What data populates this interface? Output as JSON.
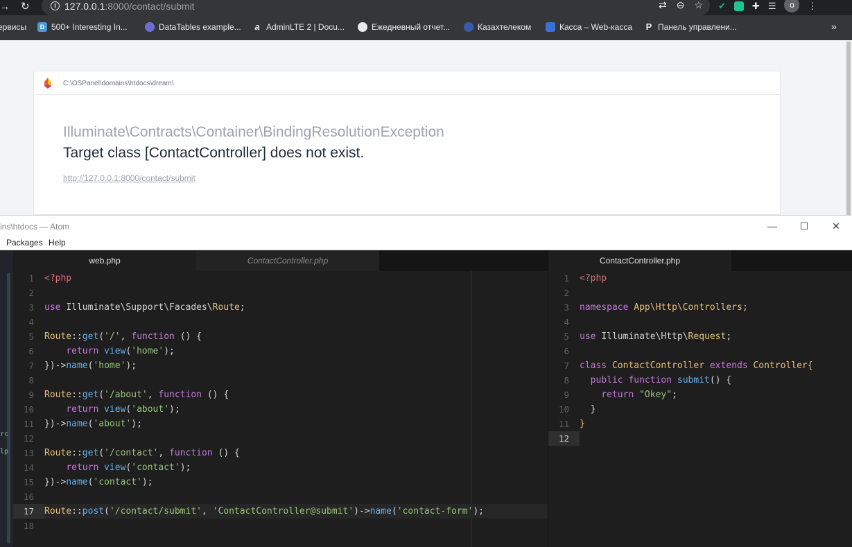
{
  "browser": {
    "url_host": "127.0.0.1",
    "url_rest": ":8000/contact/submit",
    "bookmarks": [
      "ервисы",
      "500+ Interesting In...",
      "DataTables example...",
      "AdminLTE 2 | Docu...",
      "Ежедневный отчет...",
      "Казахтелеком",
      "Касса – Web-касса",
      "Панель управлени..."
    ],
    "avatar_letter": "о",
    "more": "»"
  },
  "error_page": {
    "path": "C:\\OSPanel\\domains\\htdocs\\dream\\",
    "exception_class": "Illuminate\\Contracts\\Container\\BindingResolutionException",
    "message": "Target class [ContactController] does not exist.",
    "url": "http://127.0.0.1:8000/contact/submit"
  },
  "atom": {
    "title": "ins\\htdocs — Atom",
    "menu": [
      "Packages",
      "Help"
    ],
    "tree_fragments": [
      "rc",
      "lp"
    ],
    "left_tabs": [
      "web.php",
      "ContactController.php"
    ],
    "right_tabs": [
      "ContactController.php"
    ],
    "left_lines": [
      "1",
      "2",
      "3",
      "4",
      "5",
      "6",
      "7",
      "8",
      "9",
      "10",
      "11",
      "12",
      "13",
      "14",
      "15",
      "16",
      "17",
      "18"
    ],
    "right_lines": [
      "1",
      "2",
      "3",
      "4",
      "5",
      "6",
      "7",
      "8",
      "9",
      "10",
      "11",
      "12"
    ],
    "web_php": {
      "open_tag": "<?php",
      "use_ns": "Illuminate\\Support\\Facades\\",
      "use_cls": "Route",
      "routes": [
        {
          "method": "get",
          "path": "'/'",
          "view": "'home'",
          "name": "'home'"
        },
        {
          "method": "get",
          "path": "'/about'",
          "view": "'about'",
          "name": "'about'"
        },
        {
          "method": "get",
          "path": "'/contact'",
          "view": "'contact'",
          "name": "'contact'"
        }
      ],
      "post_path": "'/contact/submit'",
      "post_action": "'ContactController@submit'",
      "post_name": "'contact-form'"
    },
    "controller_php": {
      "open_tag": "<?php",
      "namespace": "App\\Http\\Controllers",
      "use_ns": "Illuminate\\Http\\",
      "use_cls": "Request",
      "class_name": "ContactController",
      "parent": "Controller{",
      "method": "submit",
      "return_value": "\"Okey\""
    }
  }
}
